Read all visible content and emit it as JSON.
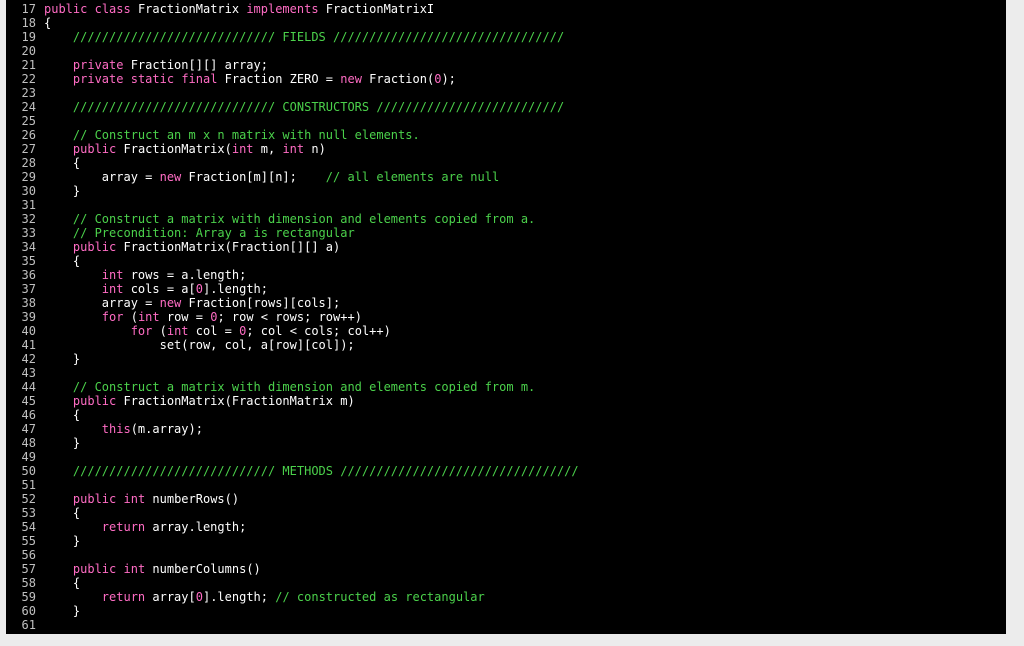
{
  "first_line": 17,
  "lines": [
    [
      [
        "kw",
        "public"
      ],
      [
        "id",
        " "
      ],
      [
        "kw",
        "class"
      ],
      [
        "id",
        " FractionMatrix "
      ],
      [
        "kw",
        "implements"
      ],
      [
        "id",
        " FractionMatrixI"
      ]
    ],
    [
      [
        "id",
        "{"
      ]
    ],
    [
      [
        "id",
        "    "
      ],
      [
        "cm",
        "//////////////////////////// FIELDS ////////////////////////////////"
      ]
    ],
    [],
    [
      [
        "id",
        "    "
      ],
      [
        "kw",
        "private"
      ],
      [
        "id",
        " Fraction[][] array;"
      ]
    ],
    [
      [
        "id",
        "    "
      ],
      [
        "kw",
        "private"
      ],
      [
        "id",
        " "
      ],
      [
        "kw",
        "static"
      ],
      [
        "id",
        " "
      ],
      [
        "kw",
        "final"
      ],
      [
        "id",
        " Fraction ZERO = "
      ],
      [
        "kw",
        "new"
      ],
      [
        "id",
        " Fraction("
      ],
      [
        "num",
        "0"
      ],
      [
        "id",
        ");"
      ]
    ],
    [],
    [
      [
        "id",
        "    "
      ],
      [
        "cm",
        "//////////////////////////// CONSTRUCTORS //////////////////////////"
      ]
    ],
    [],
    [
      [
        "id",
        "    "
      ],
      [
        "cm",
        "// Construct an m x n matrix with null elements."
      ]
    ],
    [
      [
        "id",
        "    "
      ],
      [
        "kw",
        "public"
      ],
      [
        "id",
        " FractionMatrix("
      ],
      [
        "kw",
        "int"
      ],
      [
        "id",
        " m, "
      ],
      [
        "kw",
        "int"
      ],
      [
        "id",
        " n)"
      ]
    ],
    [
      [
        "id",
        "    {"
      ]
    ],
    [
      [
        "id",
        "        array = "
      ],
      [
        "kw",
        "new"
      ],
      [
        "id",
        " Fraction[m][n];    "
      ],
      [
        "cm",
        "// all elements are null"
      ]
    ],
    [
      [
        "id",
        "    }"
      ]
    ],
    [],
    [
      [
        "id",
        "    "
      ],
      [
        "cm",
        "// Construct a matrix with dimension and elements copied from a."
      ]
    ],
    [
      [
        "id",
        "    "
      ],
      [
        "cm",
        "// Precondition: Array a is rectangular"
      ]
    ],
    [
      [
        "id",
        "    "
      ],
      [
        "kw",
        "public"
      ],
      [
        "id",
        " FractionMatrix(Fraction[][] a)"
      ]
    ],
    [
      [
        "id",
        "    {"
      ]
    ],
    [
      [
        "id",
        "        "
      ],
      [
        "kw",
        "int"
      ],
      [
        "id",
        " rows = a.length;"
      ]
    ],
    [
      [
        "id",
        "        "
      ],
      [
        "kw",
        "int"
      ],
      [
        "id",
        " cols = a["
      ],
      [
        "num",
        "0"
      ],
      [
        "id",
        "].length;"
      ]
    ],
    [
      [
        "id",
        "        array = "
      ],
      [
        "kw",
        "new"
      ],
      [
        "id",
        " Fraction[rows][cols];"
      ]
    ],
    [
      [
        "id",
        "        "
      ],
      [
        "kw",
        "for"
      ],
      [
        "id",
        " ("
      ],
      [
        "kw",
        "int"
      ],
      [
        "id",
        " row = "
      ],
      [
        "num",
        "0"
      ],
      [
        "id",
        "; row < rows; row++)"
      ]
    ],
    [
      [
        "id",
        "            "
      ],
      [
        "kw",
        "for"
      ],
      [
        "id",
        " ("
      ],
      [
        "kw",
        "int"
      ],
      [
        "id",
        " col = "
      ],
      [
        "num",
        "0"
      ],
      [
        "id",
        "; col < cols; col++)"
      ]
    ],
    [
      [
        "id",
        "                set(row, col, a[row][col]);"
      ]
    ],
    [
      [
        "id",
        "    }"
      ]
    ],
    [],
    [
      [
        "id",
        "    "
      ],
      [
        "cm",
        "// Construct a matrix with dimension and elements copied from m."
      ]
    ],
    [
      [
        "id",
        "    "
      ],
      [
        "kw",
        "public"
      ],
      [
        "id",
        " FractionMatrix(FractionMatrix m)"
      ]
    ],
    [
      [
        "id",
        "    {"
      ]
    ],
    [
      [
        "id",
        "        "
      ],
      [
        "kw",
        "this"
      ],
      [
        "id",
        "(m.array);"
      ]
    ],
    [
      [
        "id",
        "    }"
      ]
    ],
    [],
    [
      [
        "id",
        "    "
      ],
      [
        "cm",
        "//////////////////////////// METHODS /////////////////////////////////"
      ]
    ],
    [],
    [
      [
        "id",
        "    "
      ],
      [
        "kw",
        "public"
      ],
      [
        "id",
        " "
      ],
      [
        "kw",
        "int"
      ],
      [
        "id",
        " numberRows()"
      ]
    ],
    [
      [
        "id",
        "    {"
      ]
    ],
    [
      [
        "id",
        "        "
      ],
      [
        "kw",
        "return"
      ],
      [
        "id",
        " array.length;"
      ]
    ],
    [
      [
        "id",
        "    }"
      ]
    ],
    [],
    [
      [
        "id",
        "    "
      ],
      [
        "kw",
        "public"
      ],
      [
        "id",
        " "
      ],
      [
        "kw",
        "int"
      ],
      [
        "id",
        " numberColumns()"
      ]
    ],
    [
      [
        "id",
        "    {"
      ]
    ],
    [
      [
        "id",
        "        "
      ],
      [
        "kw",
        "return"
      ],
      [
        "id",
        " array["
      ],
      [
        "num",
        "0"
      ],
      [
        "id",
        "].length; "
      ],
      [
        "cm",
        "// constructed as rectangular"
      ]
    ],
    [
      [
        "id",
        "    }"
      ]
    ],
    []
  ]
}
